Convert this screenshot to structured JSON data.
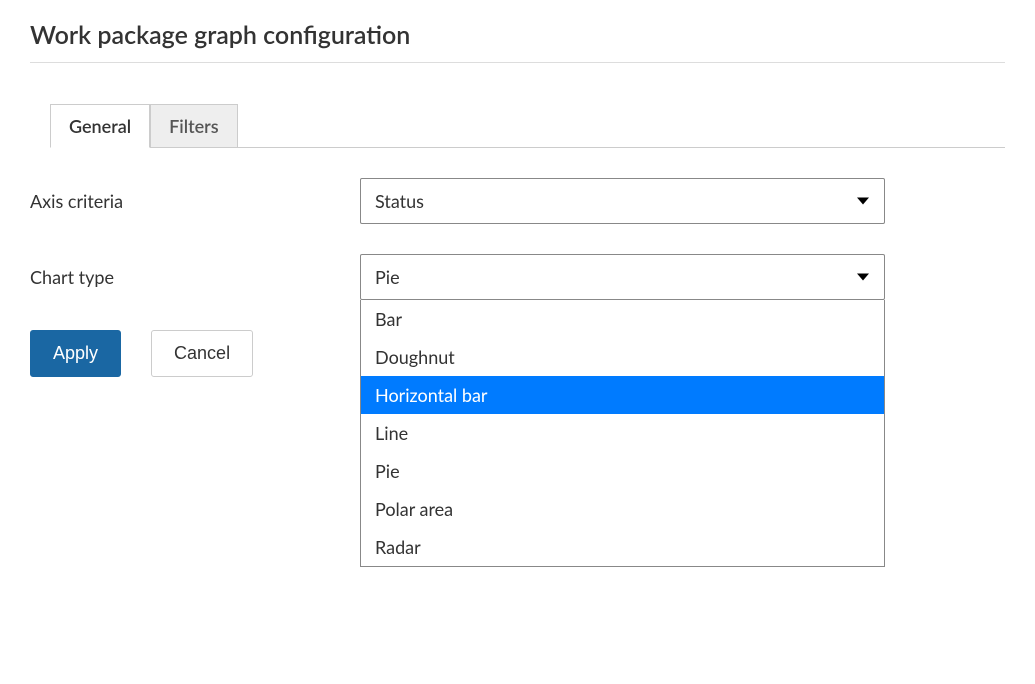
{
  "title": "Work package graph configuration",
  "tabs": {
    "general": "General",
    "filters": "Filters"
  },
  "form": {
    "axisCriteria": {
      "label": "Axis criteria",
      "value": "Status"
    },
    "chartType": {
      "label": "Chart type",
      "value": "Pie",
      "options": [
        "Bar",
        "Doughnut",
        "Horizontal bar",
        "Line",
        "Pie",
        "Polar area",
        "Radar"
      ],
      "highlightedIndex": 2
    }
  },
  "buttons": {
    "apply": "Apply",
    "cancel": "Cancel"
  }
}
